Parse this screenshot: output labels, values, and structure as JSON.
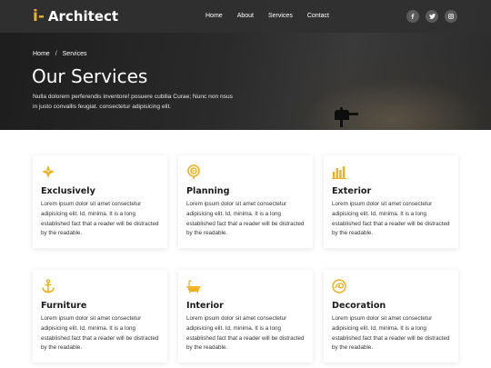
{
  "brand": {
    "mark": "i-",
    "name": "Architect",
    "accent_color": "#f2b01e"
  },
  "nav": {
    "items": [
      "Home",
      "About",
      "Services",
      "Contact"
    ]
  },
  "socials": [
    {
      "icon": "facebook-icon"
    },
    {
      "icon": "twitter-icon"
    },
    {
      "icon": "instagram-icon"
    }
  ],
  "breadcrumb": {
    "home": "Home",
    "separator": "/",
    "current": "Services"
  },
  "hero": {
    "title": "Our Services",
    "description": "Nulla dolorem perferendis inventore! posuere cubilia Curae; Nunc non nsus in justo convallis feugiat. consectetur adipisicing elit."
  },
  "services": [
    {
      "icon": "compass-icon",
      "title": "Exclusively",
      "text": "Lorem ipsum dolor sit amet consectetur adipisicing elit. Id, minima. It is a long established fact that a reader will be distracted by the readable."
    },
    {
      "icon": "target-icon",
      "title": "Planning",
      "text": "Lorem ipsum dolor sit amet consectetur adipisicing elit. Id, minima. It is a long established fact that a reader will be distracted by the readable."
    },
    {
      "icon": "bar-chart-icon",
      "title": "Exterior",
      "text": "Lorem ipsum dolor sit amet consectetur adipisicing elit. Id, minima. It is a long established fact that a reader will be distracted by the readable."
    },
    {
      "icon": "anchor-icon",
      "title": "Furniture",
      "text": "Lorem ipsum dolor sit amet consectetur adipisicing elit. Id, minima. It is a long established fact that a reader will be distracted by the readable."
    },
    {
      "icon": "bathtub-icon",
      "title": "Interior",
      "text": "Lorem ipsum dolor sit amet consectetur adipisicing elit. Id, minima. It is a long established fact that a reader will be distracted by the readable."
    },
    {
      "icon": "swirl-icon",
      "title": "Decoration",
      "text": "Lorem ipsum dolor sit amet consectetur adipisicing elit. Id, minima. It is a long established fact that a reader will be distracted by the readable."
    }
  ]
}
